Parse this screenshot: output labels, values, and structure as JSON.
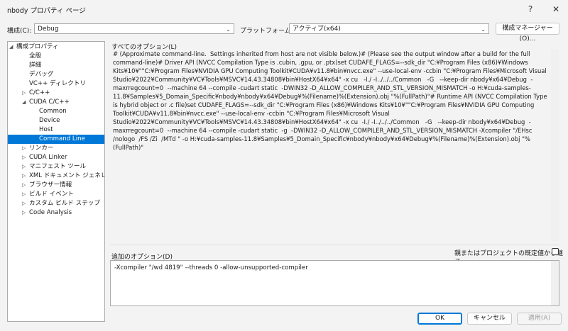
{
  "window": {
    "title": "nbody プロパティ ページ",
    "help_glyph": "?",
    "close_glyph": "✕"
  },
  "toolbar": {
    "config_label": "構成(C):",
    "config_value": "Debug",
    "platform_label": "プラットフォーム(P):",
    "platform_value": "アクティブ(x64)",
    "config_manager_label": "構成マネージャー(O)..."
  },
  "tree": {
    "items": [
      {
        "label": "構成プロパティ",
        "expander": "◢"
      },
      {
        "label": "全般",
        "expander": ""
      },
      {
        "label": "詳細",
        "expander": ""
      },
      {
        "label": "デバッグ",
        "expander": ""
      },
      {
        "label": "VC++ ディレクトリ",
        "expander": ""
      },
      {
        "label": "C/C++",
        "expander": "▷"
      },
      {
        "label": "CUDA C/C++",
        "expander": "◢"
      },
      {
        "label": "Common",
        "expander": ""
      },
      {
        "label": "Device",
        "expander": ""
      },
      {
        "label": "Host",
        "expander": ""
      },
      {
        "label": "Command Line",
        "expander": ""
      },
      {
        "label": "リンカー",
        "expander": "▷"
      },
      {
        "label": "CUDA Linker",
        "expander": "▷"
      },
      {
        "label": "マニフェスト ツール",
        "expander": "▷"
      },
      {
        "label": "XML ドキュメント ジェネレーター",
        "expander": "▷"
      },
      {
        "label": "ブラウザー情報",
        "expander": "▷"
      },
      {
        "label": "ビルド イベント",
        "expander": "▷"
      },
      {
        "label": "カスタム ビルド ステップ",
        "expander": "▷"
      },
      {
        "label": "Code Analysis",
        "expander": "▷"
      }
    ]
  },
  "main": {
    "all_options_label": "すべてのオプション(L)",
    "all_options_text": "# (Approximate command-line.  Settings inherited from host are not visible below.)# (Please see the output window after a build for the full command-line)# Driver API (NVCC Compilation Type is .cubin, .gpu, or .ptx)set CUDAFE_FLAGS=--sdk_dir \"C:¥Program Files (x86)¥Windows Kits¥10¥\"\"C:¥Program Files¥NVIDIA GPU Computing Toolkit¥CUDA¥v11.8¥bin¥nvcc.exe\" --use-local-env -ccbin \"C:¥Program Files¥Microsoft Visual Studio¥2022¥Community¥VC¥Tools¥MSVC¥14.43.34808¥bin¥HostX64¥x64\" -x cu   -I./ -I../../../Common   -G   --keep-dir nbody¥x64¥Debug  -maxrregcount=0  --machine 64 --compile -cudart static  -DWIN32 -D_ALLOW_COMPILER_AND_STL_VERSION_MISMATCH -o H:¥cuda-samples-11.8¥Samples¥5_Domain_Specific¥nbody¥nbody¥x64¥Debug¥%(Filename)%(Extension).obj \"%(FullPath)\"# Runtime API (NVCC Compilation Type is hybrid object or .c file)set CUDAFE_FLAGS=--sdk_dir \"C:¥Program Files (x86)¥Windows Kits¥10¥\"\"C:¥Program Files¥NVIDIA GPU Computing Toolkit¥CUDA¥v11.8¥bin¥nvcc.exe\" --use-local-env -ccbin \"C:¥Program Files¥Microsoft Visual Studio¥2022¥Community¥VC¥Tools¥MSVC¥14.43.34808¥bin¥HostX64¥x64\" -x cu  -I./ -I../../../Common   -G   --keep-dir nbody¥x64¥Debug  -maxrregcount=0  --machine 64 --compile -cudart static  -g  -DWIN32 -D_ALLOW_COMPILER_AND_STL_VERSION_MISMATCH -Xcompiler \"/EHsc /nologo  /FS /Zi  /MTd \" -o H:¥cuda-samples-11.8¥Samples¥5_Domain_Specific¥nbody¥nbody¥x64¥Debug¥%(Filename)%(Extension).obj \"%(FullPath)\"",
    "additional_options_label": "追加のオプション(D)",
    "inherit_label": "親またはプロジェクトの既定値から継承",
    "additional_options_value": "-Xcompiler \"/wd 4819\"  --threads 0 -allow-unsupported-compiler"
  },
  "footer": {
    "ok_label": "OK",
    "cancel_label": "キャンセル",
    "apply_label": "適用(A)"
  },
  "colors": {
    "accent": "#0078d7",
    "window_bg": "#f3f3f3"
  }
}
